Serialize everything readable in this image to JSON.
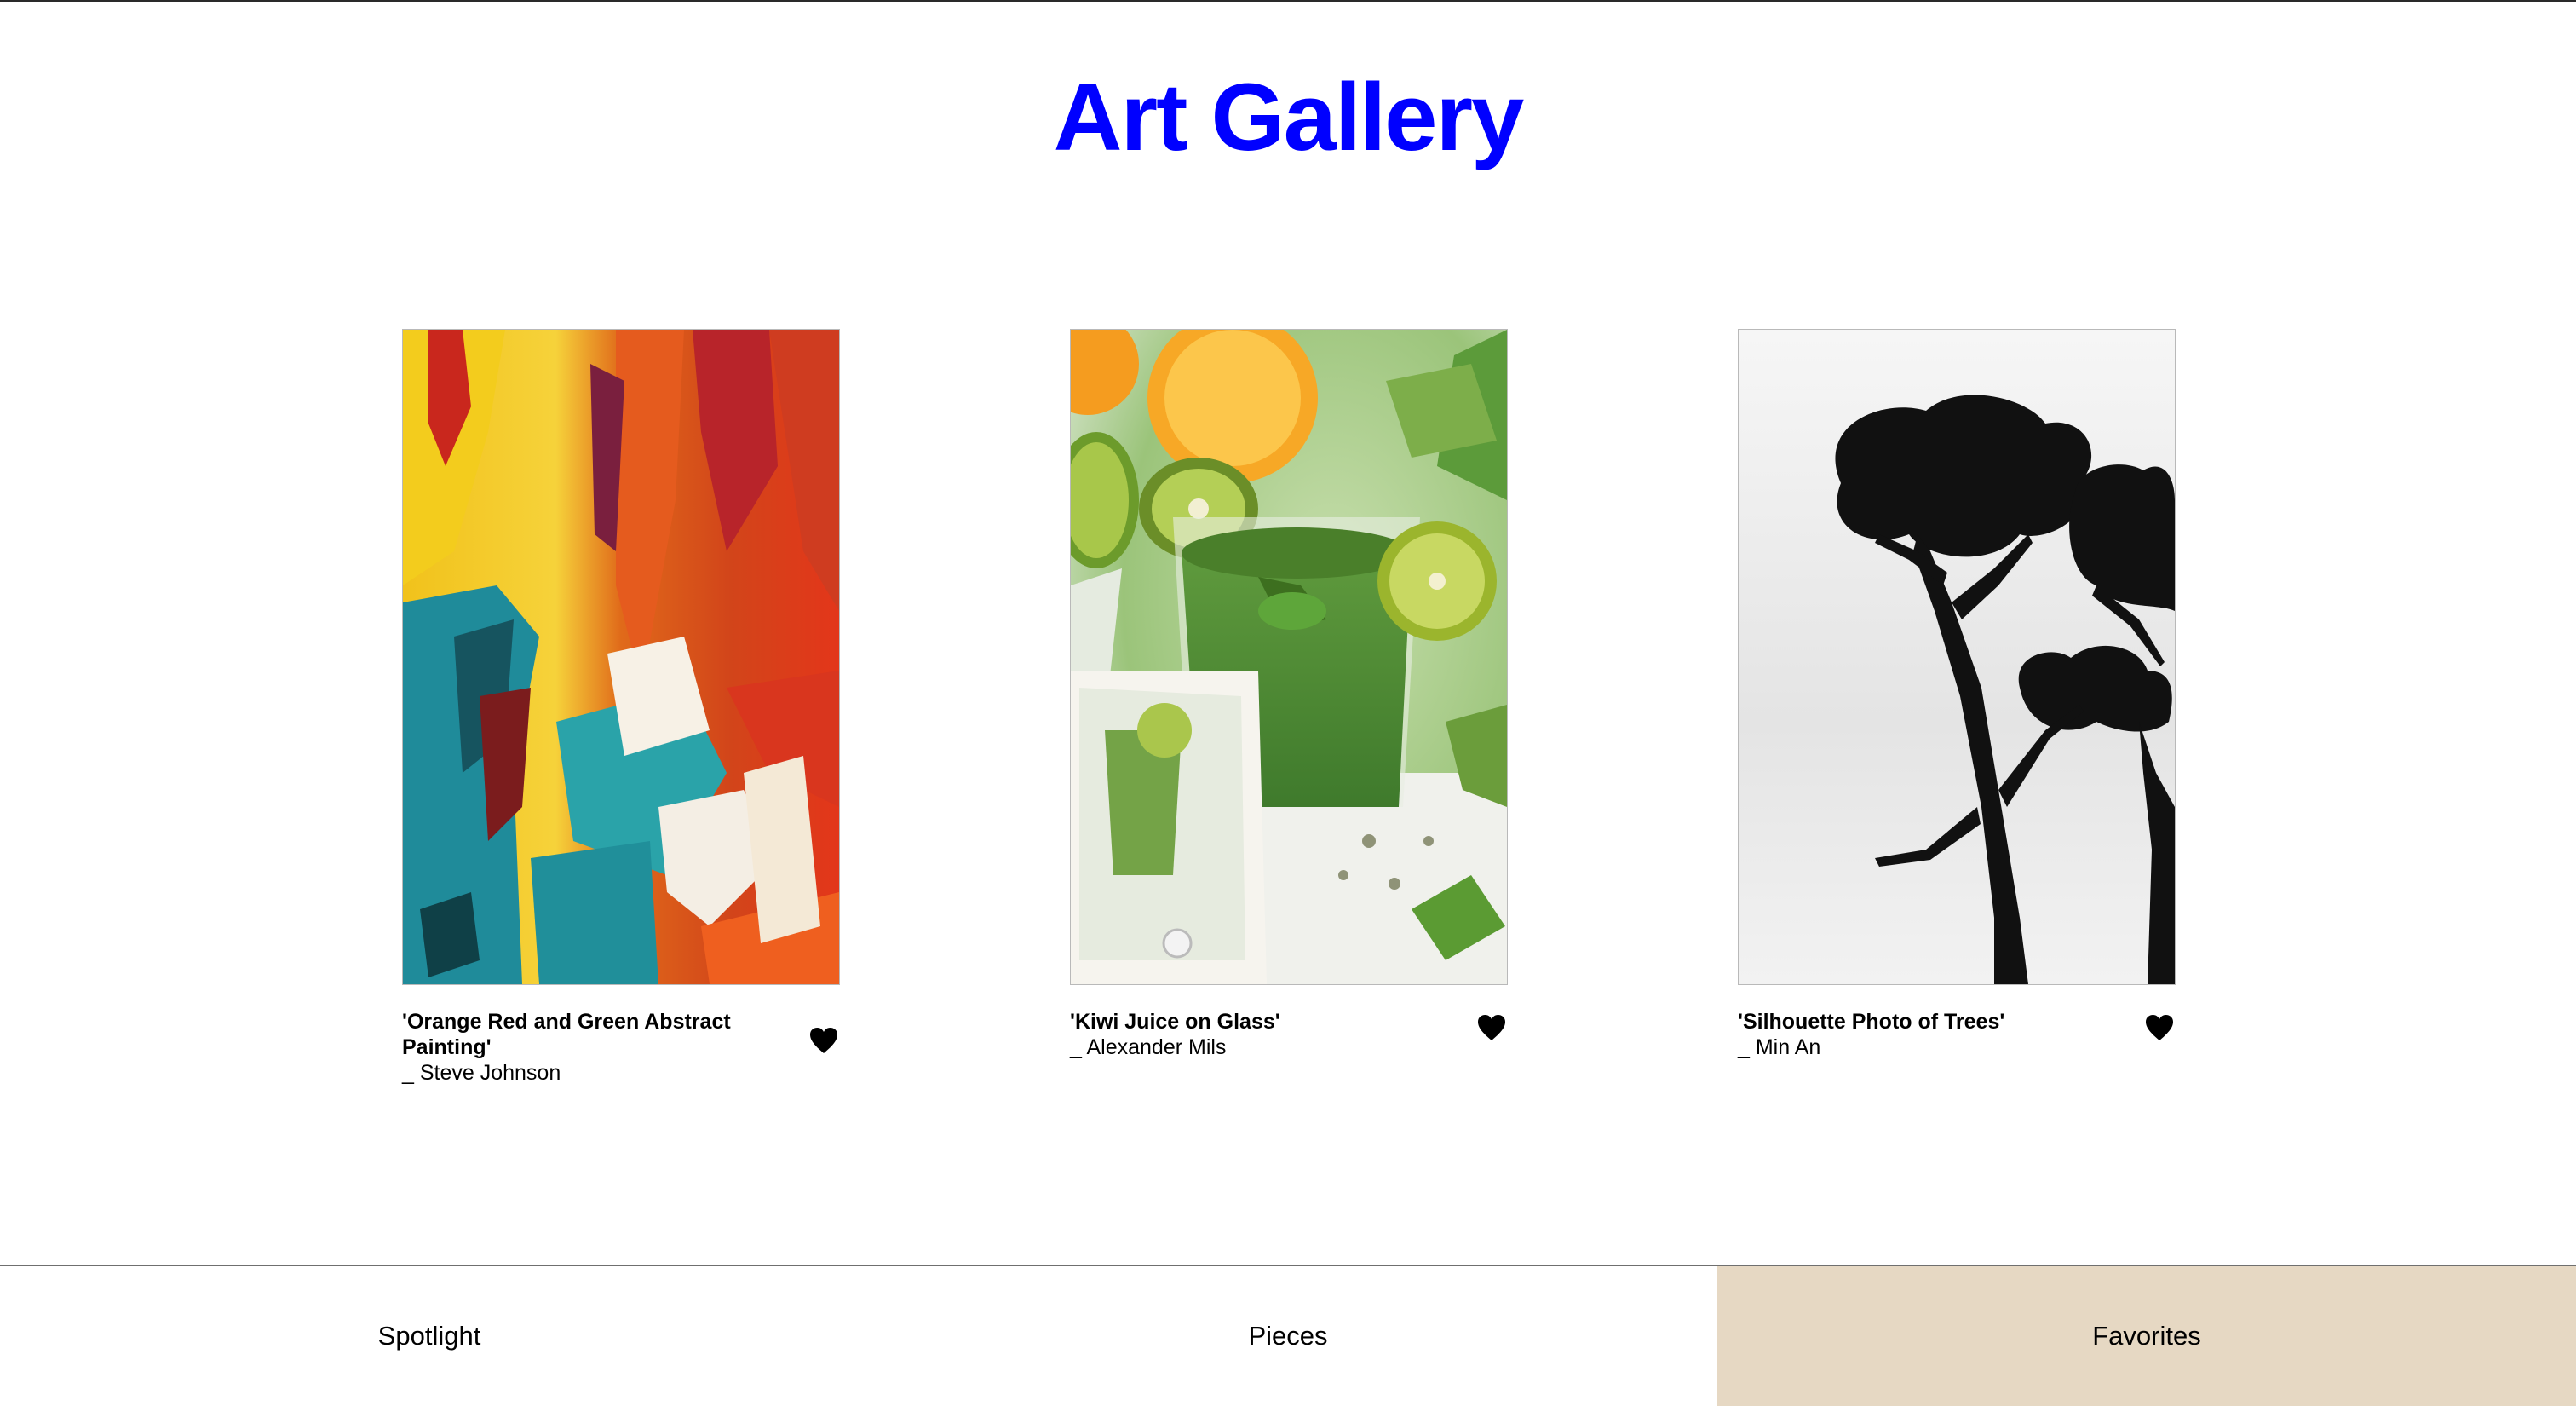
{
  "app": {
    "title": "Art Gallery",
    "title_color": "#0000ff"
  },
  "gallery": {
    "items": [
      {
        "title": "'Orange Red and Green Abstract Painting'",
        "artist": "_ Steve Johnson",
        "image": "abstract-painting-image",
        "favorited": true
      },
      {
        "title": "'Kiwi Juice on Glass'",
        "artist": "_ Alexander Mils",
        "image": "kiwi-juice-photo",
        "favorited": true
      },
      {
        "title": "'Silhouette Photo of Trees'",
        "artist": "_ Min An",
        "image": "tree-silhouette-photo",
        "favorited": true
      }
    ],
    "heart_icon": "heart-icon"
  },
  "tabs": [
    {
      "label": "Spotlight",
      "active": false
    },
    {
      "label": "Pieces",
      "active": false
    },
    {
      "label": "Favorites",
      "active": true
    }
  ],
  "colors": {
    "active_tab_bg": "#e6d8c3",
    "heart": "#000000"
  }
}
